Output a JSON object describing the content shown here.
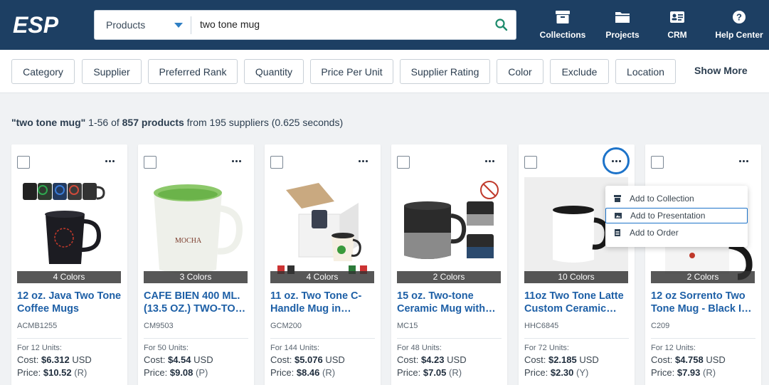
{
  "header": {
    "logo_text": "ESP",
    "search": {
      "category": "Products",
      "query": "two tone mug"
    },
    "nav": [
      {
        "label": "Collections",
        "icon": "archive-icon"
      },
      {
        "label": "Projects",
        "icon": "folder-icon"
      },
      {
        "label": "CRM",
        "icon": "contact-card-icon"
      },
      {
        "label": "Help Center",
        "icon": "help-icon"
      }
    ]
  },
  "filters": [
    "Category",
    "Supplier",
    "Preferred Rank",
    "Quantity",
    "Price Per Unit",
    "Supplier Rating",
    "Color",
    "Exclude",
    "Location"
  ],
  "show_more": "Show More",
  "summary": {
    "query": "\"two tone mug\"",
    "range": "1-56 of",
    "count": "857 products",
    "rest": "from 195 suppliers (0.625 seconds)"
  },
  "products": [
    {
      "colors": "4 Colors",
      "title": "12 oz. Java Two Tone Coffee Mugs",
      "sku": "ACMB1255",
      "units": "For 12 Units:",
      "cost": "$6.312",
      "cost_currency": "USD",
      "price": "$10.52",
      "price_code": "(R)"
    },
    {
      "colors": "3 Colors",
      "title": "CAFE BIEN 400 ML. (13.5 OZ.) TWO-TO…",
      "sku": "CM9503",
      "units": "For 50 Units:",
      "cost": "$4.54",
      "cost_currency": "USD",
      "price": "$9.08",
      "price_code": "(P)"
    },
    {
      "colors": "4 Colors",
      "title": "11 oz. Two Tone C-Handle Mug in…",
      "sku": "GCM200",
      "units": "For 144 Units:",
      "cost": "$5.076",
      "cost_currency": "USD",
      "price": "$8.46",
      "price_code": "(R)"
    },
    {
      "colors": "2 Colors",
      "title": "15 oz. Two-tone Ceramic Mug with…",
      "sku": "MC15",
      "units": "For 48 Units:",
      "cost": "$4.23",
      "cost_currency": "USD",
      "price": "$7.05",
      "price_code": "(R)"
    },
    {
      "colors": "10 Colors",
      "title": "11oz Two Tone Latte Custom Ceramic…",
      "sku": "HHC6845",
      "units": "For 72 Units:",
      "cost": "$2.185",
      "cost_currency": "USD",
      "price": "$2.30",
      "price_code": "(Y)"
    },
    {
      "colors": "2 Colors",
      "title": "12 oz Sorrento Two Tone Mug - Black I…",
      "sku": "C209",
      "units": "For 12 Units:",
      "cost": "$4.758",
      "cost_currency": "USD",
      "price": "$7.93",
      "price_code": "(R)"
    }
  ],
  "labels": {
    "cost": "Cost:",
    "price": "Price:"
  },
  "menu": {
    "items": [
      {
        "label": "Add to Collection",
        "icon": "archive-icon"
      },
      {
        "label": "Add to Presentation",
        "icon": "presentation-icon"
      },
      {
        "label": "Add to Order",
        "icon": "document-icon"
      }
    ]
  },
  "colors": {
    "header": "#1d3f63",
    "link": "#1d5fa6",
    "accent": "#1d73c9"
  }
}
